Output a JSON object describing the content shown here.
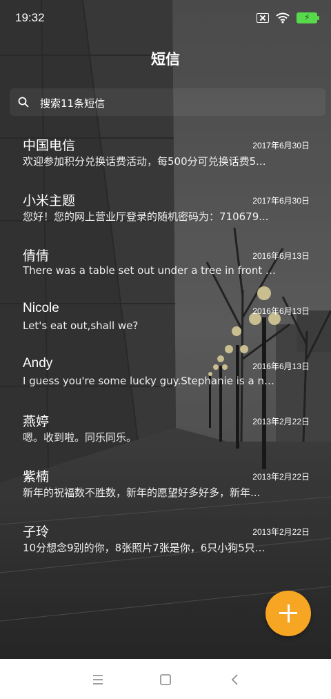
{
  "status": {
    "time": "19:32"
  },
  "header": {
    "title": "短信"
  },
  "search": {
    "placeholder": "搜索11条短信"
  },
  "messages": [
    {
      "name": "中国电信",
      "date": "2017年6月30日",
      "preview": "欢迎参加积分兑换话费活动，每500分可兑换话费5..."
    },
    {
      "name": "小米主题",
      "date": "2017年6月30日",
      "preview": "您好！您的网上营业厅登录的随机密码为：710679..."
    },
    {
      "name": "倩倩",
      "date": "2016年6月13日",
      "preview": "There was a table set out under a tree in front of ..."
    },
    {
      "name": "Nicole",
      "date": "2016年6月13日",
      "preview": "Let's eat out,shall we?"
    },
    {
      "name": "Andy",
      "date": "2016年6月13日",
      "preview": "I guess you're some lucky guy.Stephanie is a ni..."
    },
    {
      "name": "燕婷",
      "date": "2013年2月22日",
      "preview": "嗯。收到啦。同乐同乐。"
    },
    {
      "name": "紫楠",
      "date": "2013年2月22日",
      "preview": "新年的祝福数不胜数，新年的愿望好多好多，新年..."
    },
    {
      "name": "子玲",
      "date": "2013年2月22日",
      "preview": "10分想念9别的你，8张照片7张是你，6只小狗5只..."
    }
  ],
  "colors": {
    "fab": "#f6a623",
    "battery": "#58d94b"
  },
  "icons": {
    "search": "search-icon",
    "fab": "plus-icon",
    "nav": [
      "menu-icon",
      "home-icon",
      "back-icon"
    ]
  }
}
